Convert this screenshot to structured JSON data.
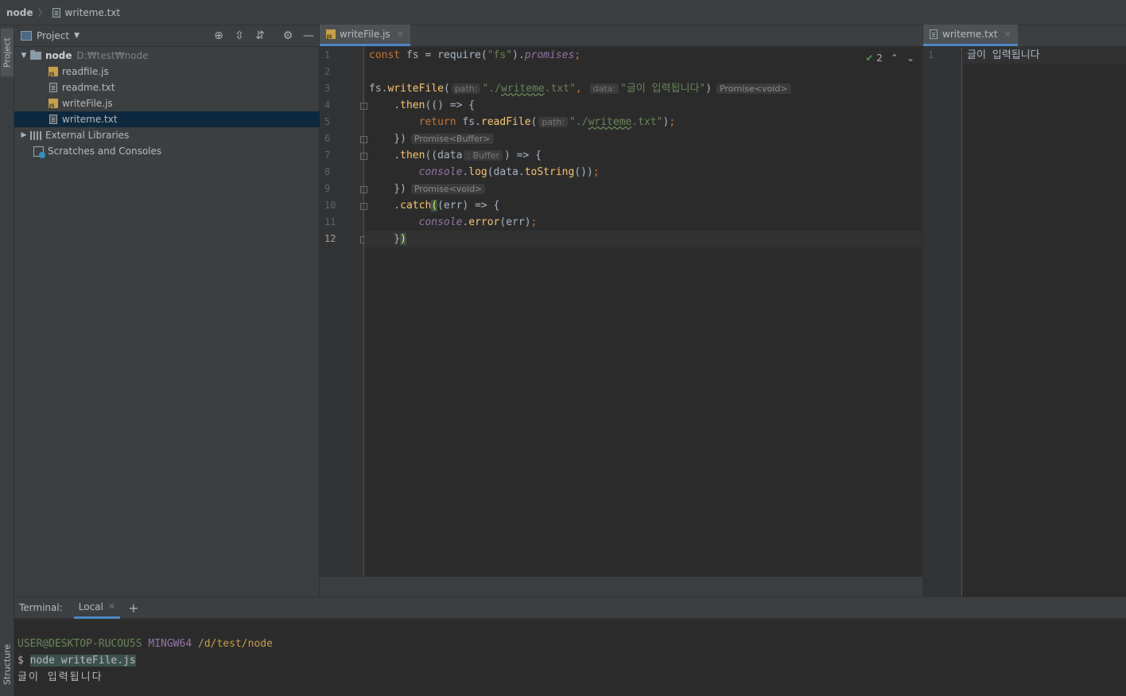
{
  "navbar": {
    "project": "node",
    "file": "writeme.txt"
  },
  "left_strip": {
    "project_label": "Project",
    "structure_label": "Structure"
  },
  "project_panel": {
    "title": "Project",
    "tree": {
      "root_name": "node",
      "root_path": "D:₩test₩node",
      "files": [
        "readfile.js",
        "readme.txt",
        "writeFile.js",
        "writeme.txt"
      ],
      "external_libraries": "External Libraries",
      "scratches": "Scratches and Consoles"
    }
  },
  "editor": {
    "tab_label": "writeFile.js",
    "inspection_count": "2",
    "line_numbers": [
      "1",
      "2",
      "3",
      "4",
      "5",
      "6",
      "7",
      "8",
      "9",
      "10",
      "11",
      "12"
    ],
    "hints": {
      "path": "path:",
      "data": "data:",
      "promise_void": "Promise<void>",
      "promise_buffer": "Promise<Buffer>",
      "buffer": ": Buffer"
    }
  },
  "preview": {
    "tab_label": "writeme.txt",
    "line_number": "1",
    "content": "글이 입력됩니다"
  },
  "terminal": {
    "label": "Terminal:",
    "tab_label": "Local",
    "prompt_user": "USER@DESKTOP-RUCOU5S",
    "prompt_host": "MINGW64",
    "prompt_path": "/d/test/node",
    "command": "node writeFile.js",
    "output": "글이 입력됩니다"
  },
  "colors": {
    "background": "#2b2b2b",
    "panel": "#3c3f41",
    "selection": "#0d293e",
    "keyword": "#cc7832",
    "function": "#ffc66d",
    "string": "#6a8759",
    "property": "#9876aa"
  }
}
